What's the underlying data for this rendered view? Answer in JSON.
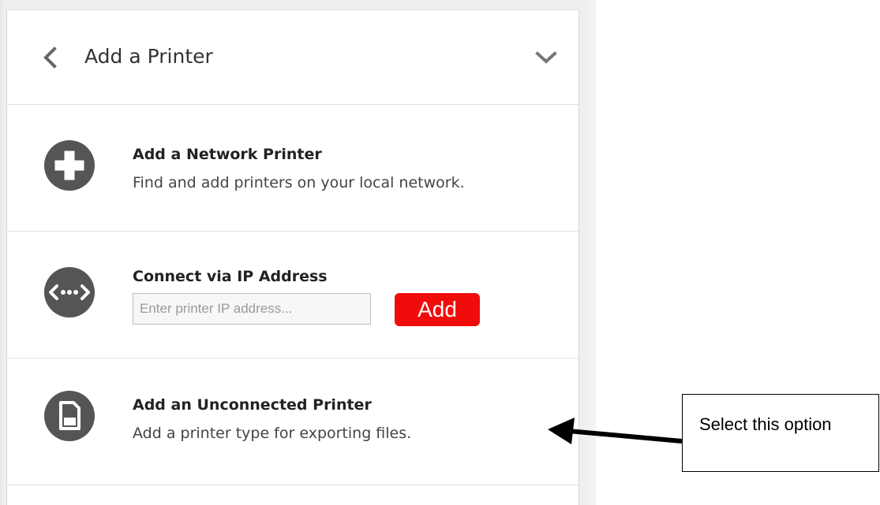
{
  "header": {
    "title": "Add a Printer",
    "back_icon": "chevron-left-icon",
    "collapse_icon": "chevron-down-icon"
  },
  "options": [
    {
      "title": "Add a Network Printer",
      "description": "Find and add printers on your local network.",
      "icon": "plus-circle-icon"
    },
    {
      "title": "Connect via IP Address",
      "input_placeholder": "Enter printer IP address...",
      "input_value": "",
      "button_label": "Add",
      "icon": "network-connection-icon"
    },
    {
      "title": "Add an Unconnected Printer",
      "description": "Add a printer type for exporting files.",
      "icon": "sd-card-icon"
    }
  ],
  "annotation": {
    "callout_text": "Select this option"
  },
  "colors": {
    "icon_circle": "#555555",
    "add_button": "#f10c0c",
    "title_text": "#333333"
  }
}
